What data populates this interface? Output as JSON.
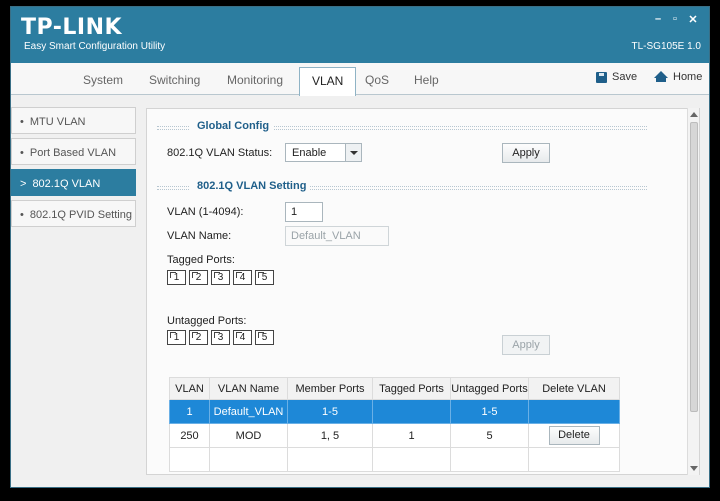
{
  "app": {
    "brand": "TP-LINK",
    "subtitle": "Easy Smart Configuration Utility",
    "model": "TL-SG105E 1.0",
    "controls": {
      "minimize": "–",
      "maximize": "▫",
      "close": "✕"
    }
  },
  "menu": {
    "tabs": [
      {
        "label": "System"
      },
      {
        "label": "Switching"
      },
      {
        "label": "Monitoring"
      },
      {
        "label": "VLAN",
        "active": true
      },
      {
        "label": "QoS"
      },
      {
        "label": "Help"
      }
    ],
    "save_label": "Save",
    "home_label": "Home"
  },
  "sidebar": {
    "items": [
      {
        "label": "MTU VLAN",
        "bullet": "•"
      },
      {
        "label": "Port Based VLAN",
        "bullet": "•"
      },
      {
        "label": "802.1Q VLAN",
        "bullet": ">",
        "active": true
      },
      {
        "label": "802.1Q PVID Setting",
        "bullet": "•"
      }
    ]
  },
  "global_config": {
    "title": "Global Config",
    "status_label": "802.1Q VLAN Status:",
    "status_value": "Enable",
    "apply_label": "Apply"
  },
  "vlan_setting": {
    "title": "802.1Q VLAN Setting",
    "vlan_id_label": "VLAN (1-4094):",
    "vlan_id_value": "1",
    "vlan_name_label": "VLAN Name:",
    "vlan_name_value": "Default_VLAN",
    "tagged_label": "Tagged Ports:",
    "untagged_label": "Untagged Ports:",
    "ports": [
      "1",
      "2",
      "3",
      "4",
      "5"
    ],
    "apply_label": "Apply"
  },
  "table": {
    "columns": [
      "VLAN",
      "VLAN Name",
      "Member Ports",
      "Tagged Ports",
      "Untagged Ports",
      "Delete VLAN"
    ],
    "rows": [
      {
        "vlan": "1",
        "name": "Default_VLAN",
        "member": "1-5",
        "tagged": "",
        "untagged": "1-5",
        "delete": ""
      },
      {
        "vlan": "250",
        "name": "MOD",
        "member": "1, 5",
        "tagged": "1",
        "untagged": "5",
        "delete": "Delete"
      }
    ]
  },
  "colors": {
    "accent": "#2c7da0",
    "selected_row": "#1e88d7"
  }
}
